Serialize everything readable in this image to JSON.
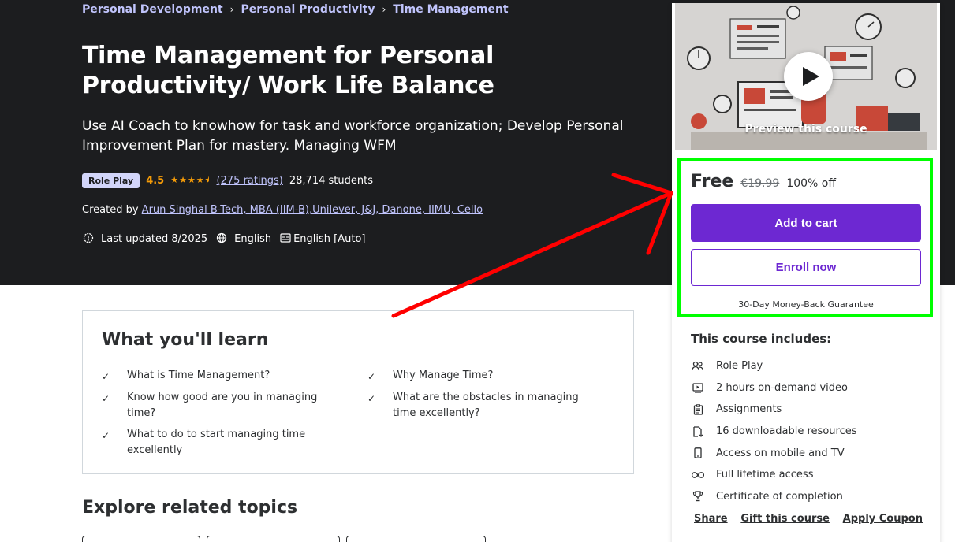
{
  "breadcrumb": {
    "items": [
      "Personal Development",
      "Personal Productivity",
      "Time Management"
    ]
  },
  "course": {
    "title": "Time Management for Personal Productivity/ Work Life Balance",
    "subtitle": "Use AI Coach to knowhow for task and workforce organization; Develop Personal Improvement Plan for mastery. Managing WFM",
    "badge": "Role Play",
    "rating": "4.5",
    "rating_stars": 4.5,
    "ratings_count": "(275 ratings)",
    "students": "28,714 students",
    "created_by_label": "Created by",
    "author": "Arun Singhal B-Tech, MBA (IIM-B),Unilever, J&J, Danone, IIMU, Cello",
    "last_updated": "Last updated 8/2025",
    "language": "English",
    "captions": "English [Auto]"
  },
  "sidebar": {
    "preview_label": "Preview this course",
    "price": "Free",
    "original_price": "€19.99",
    "discount": "100% off",
    "add_to_cart": "Add to cart",
    "enroll_now": "Enroll now",
    "guarantee": "30-Day Money-Back Guarantee",
    "includes_title": "This course includes:",
    "includes": [
      {
        "icon": "role-play-icon",
        "label": "Role Play"
      },
      {
        "icon": "video-icon",
        "label": "2 hours on-demand video"
      },
      {
        "icon": "assignment-icon",
        "label": "Assignments"
      },
      {
        "icon": "download-icon",
        "label": "16 downloadable resources"
      },
      {
        "icon": "mobile-icon",
        "label": "Access on mobile and TV"
      },
      {
        "icon": "infinity-icon",
        "label": "Full lifetime access"
      },
      {
        "icon": "trophy-icon",
        "label": "Certificate of completion"
      }
    ],
    "links": {
      "share": "Share",
      "gift": "Gift this course",
      "coupon": "Apply Coupon"
    }
  },
  "learn": {
    "title": "What you'll learn",
    "items": [
      "What is Time Management?",
      "Why Manage Time?",
      "Know how good are you in managing time?",
      "What are the obstacles in managing time excellently?",
      "What to do to start managing time excellently"
    ]
  },
  "related": {
    "title": "Explore related topics"
  },
  "colors": {
    "hero_bg": "#1c1d1f",
    "accent_purple": "#6d28d2",
    "link_lavender": "#c0c4fc",
    "star_orange": "#f69c08",
    "highlight_green": "#00ff00",
    "annotation_red": "#ff0000"
  }
}
